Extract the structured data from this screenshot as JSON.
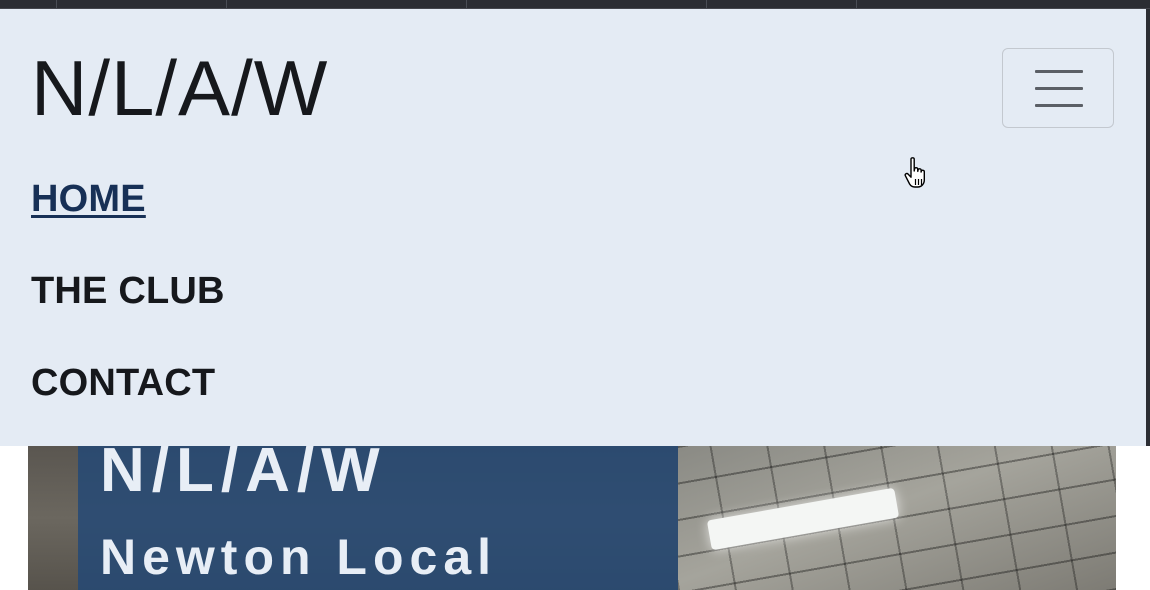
{
  "navbar": {
    "brand": "N/L/A/W",
    "toggler_icon": "hamburger-icon",
    "links": [
      {
        "label": "HOME",
        "active": true
      },
      {
        "label": "THE CLUB",
        "active": false
      },
      {
        "label": "CONTACT",
        "active": false
      }
    ]
  },
  "hero": {
    "title": "N/L/A/W",
    "subtitle": "Newton Local"
  },
  "cursor": {
    "icon": "hand-pointer-icon"
  },
  "colors": {
    "navbar_bg": "#e4ebf4",
    "active_link": "#173056",
    "text": "#16181c",
    "hero_overlay": "#224876"
  }
}
